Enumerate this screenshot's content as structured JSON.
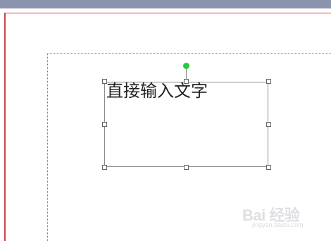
{
  "text_box": {
    "content": "直接输入文字"
  },
  "watermark": {
    "logo_mark": "Bai 经验",
    "url": "jingyan.baidu.com"
  },
  "colors": {
    "top_bar": "#8c94ad",
    "page_border": "#d0424c",
    "rotate_handle": "#27c840",
    "selection_outline": "#8a8a8a"
  }
}
